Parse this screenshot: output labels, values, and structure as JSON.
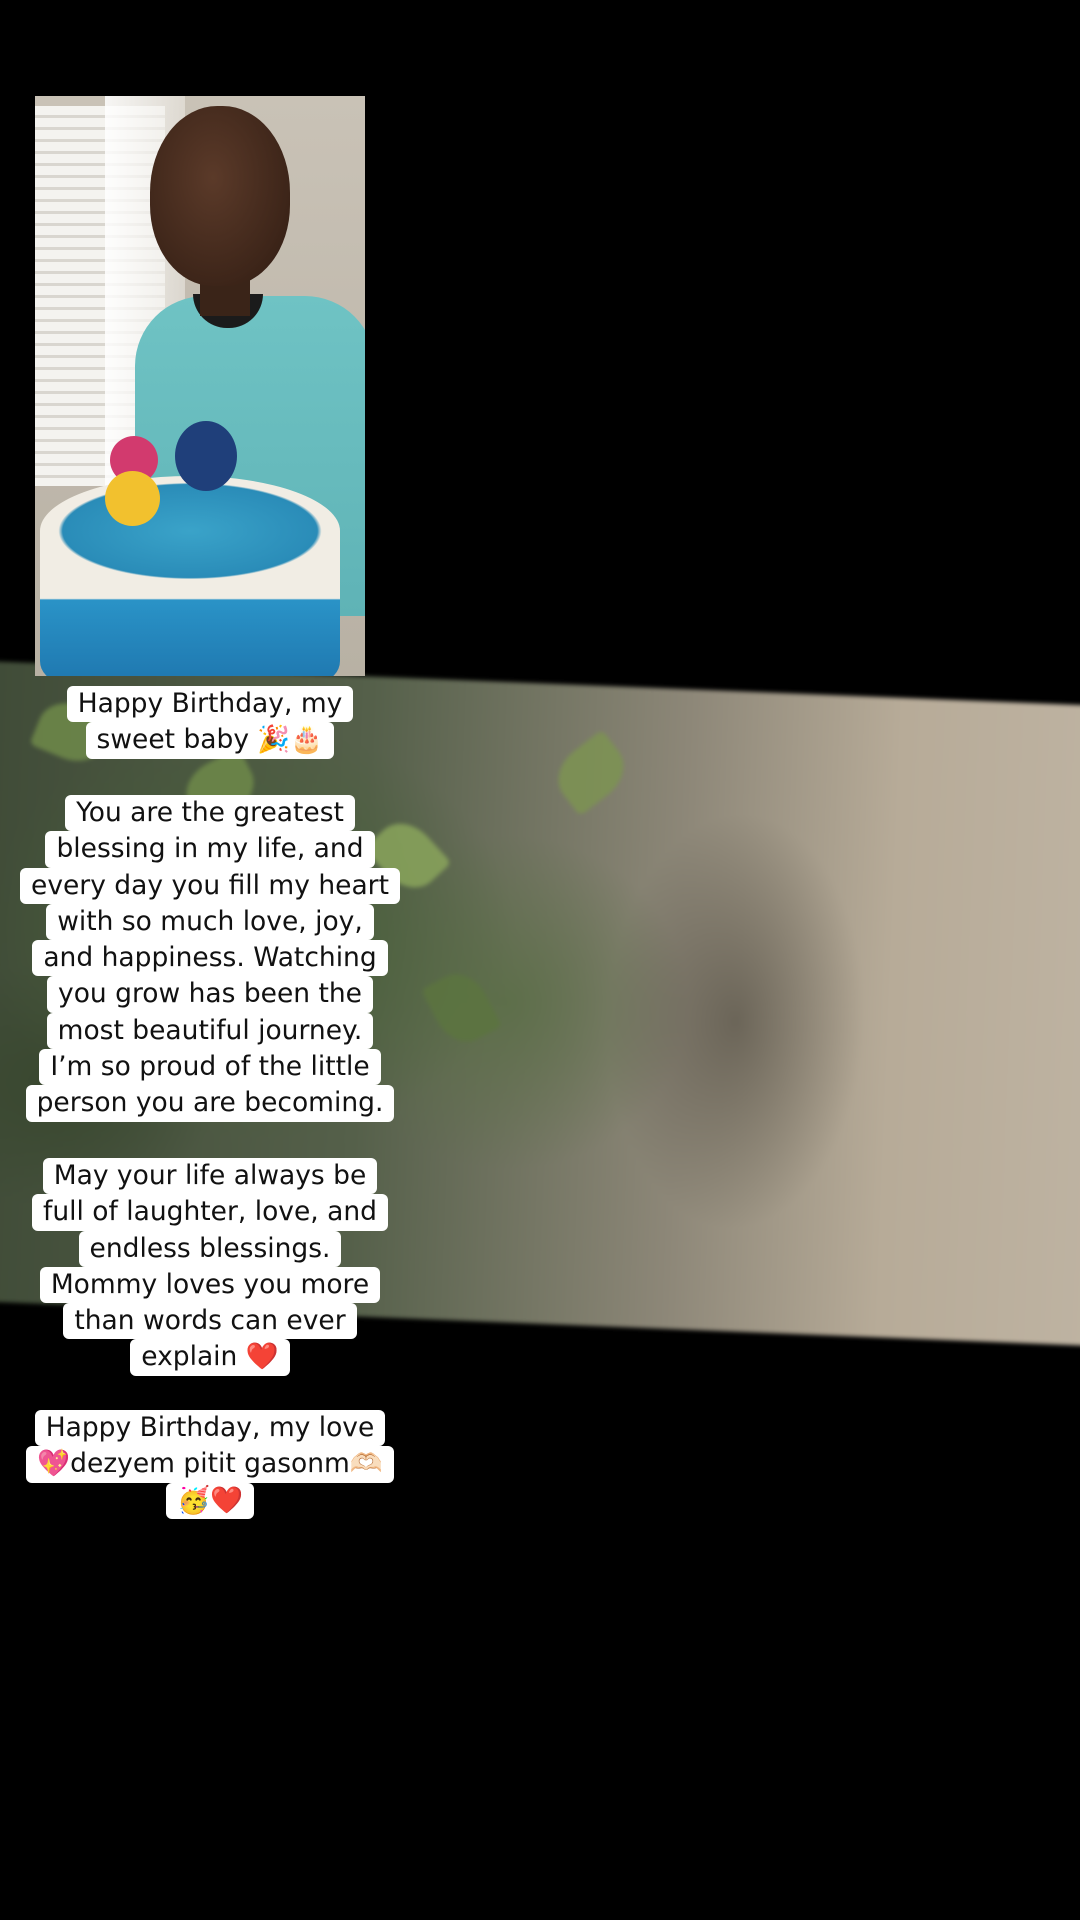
{
  "captions": [
    {
      "lines": [
        "Happy Birthday, my",
        "sweet baby 🎉🎂"
      ]
    },
    {
      "lines": [
        "You are the greatest",
        "blessing in my life, and",
        "every day you fill my heart",
        "with so much love, joy,",
        "and happiness. Watching",
        "you grow has been the",
        "most beautiful journey.",
        "I’m so proud of the little",
        "person you are becoming."
      ]
    },
    {
      "lines": [
        "May your life always be",
        "full of laughter, love, and",
        "endless blessings.",
        "Mommy loves you more",
        "than words can ever",
        "explain ❤️"
      ]
    },
    {
      "lines": [
        "Happy Birthday, my love",
        "💖dezyem pitit gasonm🫶🏻",
        "🥳❤️"
      ]
    }
  ]
}
